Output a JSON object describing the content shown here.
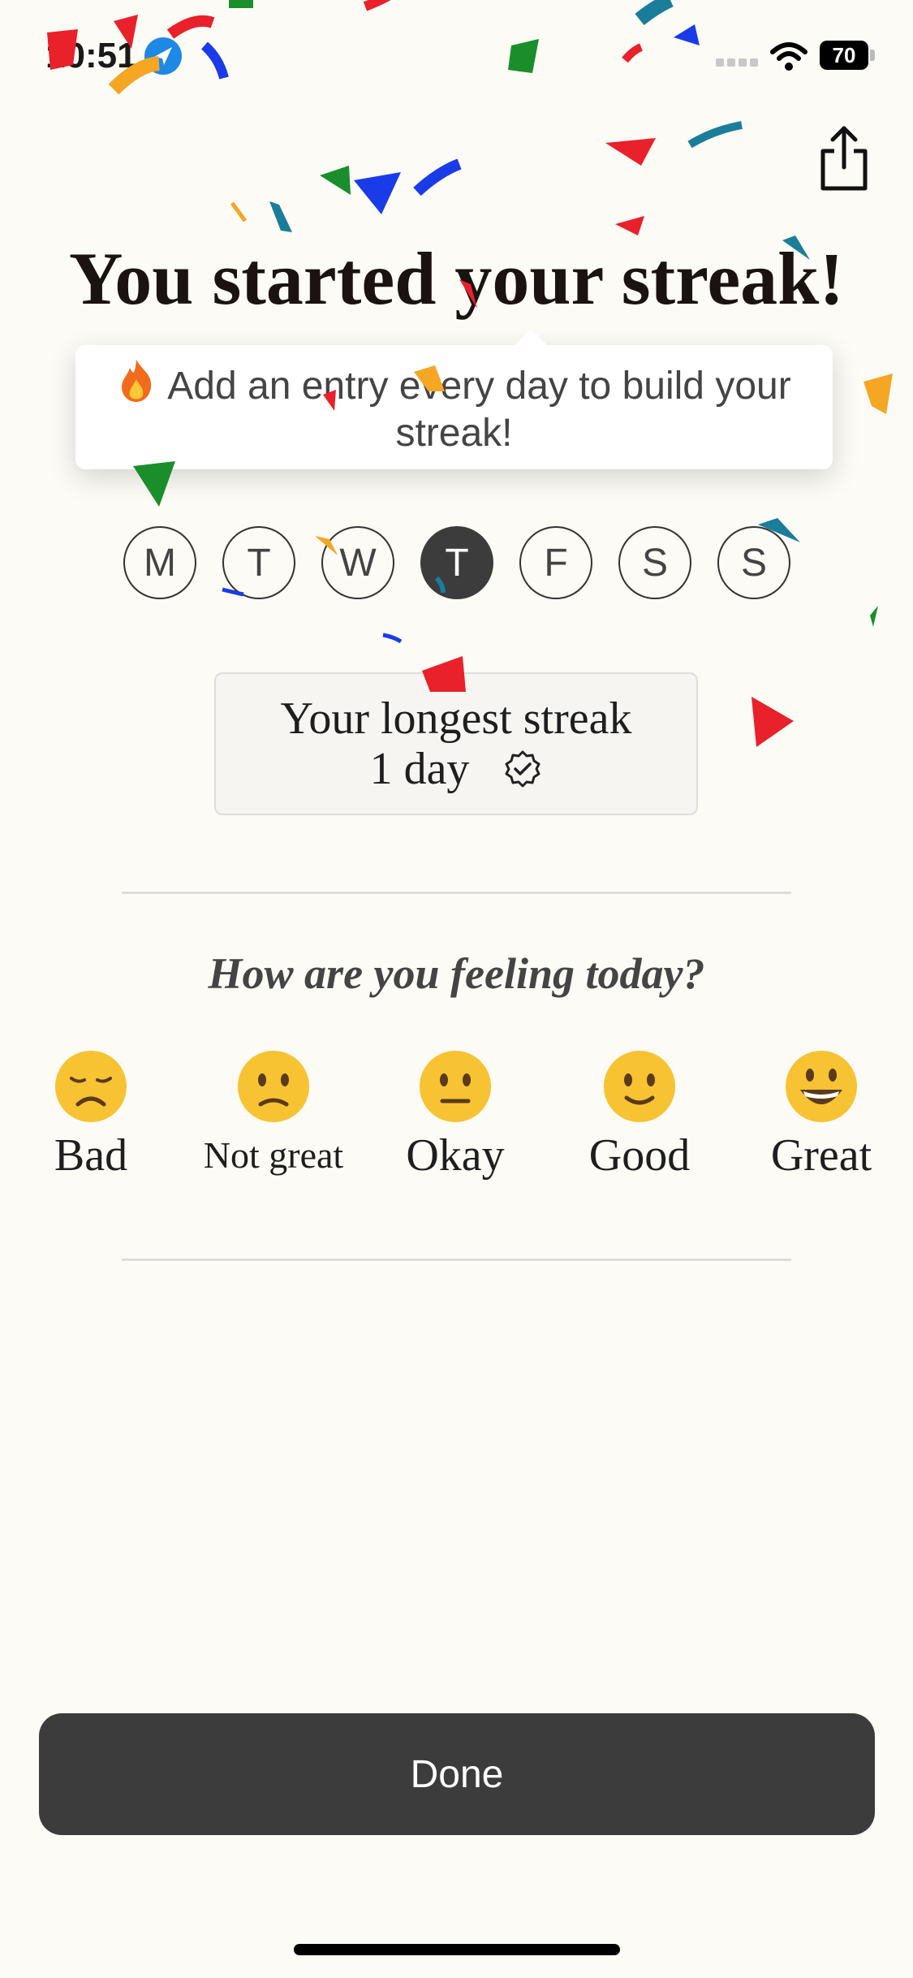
{
  "status_bar": {
    "time": "10:51",
    "battery": "70",
    "icons": [
      "location-icon",
      "signal-icon",
      "wifi-icon",
      "battery-icon"
    ]
  },
  "header": {
    "share_icon": "share-icon"
  },
  "title": "You started your streak!",
  "tooltip": {
    "icon": "fire-icon",
    "text": "Add an entry every day to build your streak!"
  },
  "week_days": [
    "M",
    "T",
    "W",
    "T",
    "F",
    "S",
    "S"
  ],
  "active_day_index": 3,
  "streak": {
    "label": "Your longest streak",
    "value": "1 day",
    "icon": "verified-badge-icon"
  },
  "mood_question": "How are you feeling today?",
  "moods": [
    {
      "label": "Bad",
      "icon": "disappointed-face-icon"
    },
    {
      "label": "Not great",
      "icon": "slightly-frowning-face-icon"
    },
    {
      "label": "Okay",
      "icon": "neutral-face-icon"
    },
    {
      "label": "Good",
      "icon": "slightly-smiling-face-icon"
    },
    {
      "label": "Great",
      "icon": "grinning-face-icon"
    }
  ],
  "done_label": "Done",
  "colors": {
    "background": "#fdfbf5",
    "button": "#3d3c3c",
    "active_day": "#3d3c3c",
    "emoji": "#f7c332",
    "confetti": [
      "#e8212b",
      "#1a8e2a",
      "#1a3be8",
      "#f5a623",
      "#1a7d9a"
    ]
  }
}
